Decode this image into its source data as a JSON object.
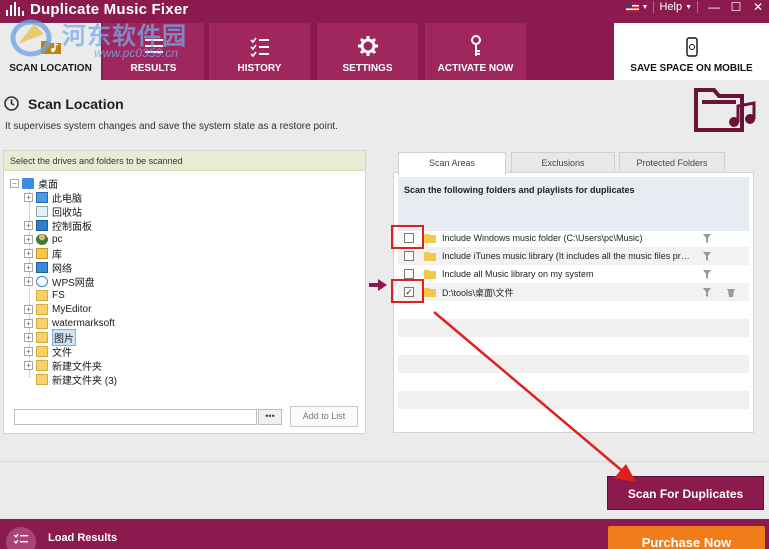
{
  "app": {
    "title": "Duplicate Music Fixer",
    "watermark_cn": "河东软件园",
    "watermark_url": "www.pc0359.cn",
    "help_label": "Help",
    "window_controls": [
      "—",
      "☐",
      "✕"
    ]
  },
  "tabs": [
    {
      "label": "SCAN LOCATION",
      "icon": "folder-music-icon",
      "active": true
    },
    {
      "label": "RESULTS",
      "icon": "list-icon",
      "active": false
    },
    {
      "label": "HISTORY",
      "icon": "checklist-icon",
      "active": false
    },
    {
      "label": "SETTINGS",
      "icon": "gear-icon",
      "active": false
    },
    {
      "label": "ACTIVATE NOW",
      "icon": "key-icon",
      "active": false
    }
  ],
  "mobile_tab": {
    "label": "SAVE SPACE ON MOBILE",
    "icon": "mobile-icon"
  },
  "page": {
    "title": "Scan Location",
    "subtitle": "It supervises system changes and save the system state as a restore point."
  },
  "left_panel": {
    "header": "Select the drives and folders to be scanned",
    "tree": [
      {
        "label": "桌面",
        "expander": "−",
        "icon": "desktop"
      },
      {
        "label": "此电脑",
        "expander": "+",
        "icon": "computer"
      },
      {
        "label": "回收站",
        "expander": "",
        "icon": "recycle"
      },
      {
        "label": "控制面板",
        "expander": "+",
        "icon": "control"
      },
      {
        "label": "pc",
        "expander": "+",
        "icon": "user"
      },
      {
        "label": "库",
        "expander": "+",
        "icon": "library"
      },
      {
        "label": "网络",
        "expander": "+",
        "icon": "network"
      },
      {
        "label": "WPS网盘",
        "expander": "+",
        "icon": "cloud"
      },
      {
        "label": "FS",
        "expander": "",
        "icon": "folder"
      },
      {
        "label": "MyEditor",
        "expander": "+",
        "icon": "folder"
      },
      {
        "label": "watermarksoft",
        "expander": "+",
        "icon": "folder"
      },
      {
        "label": "图片",
        "expander": "+",
        "icon": "folder",
        "selected": true
      },
      {
        "label": "文件",
        "expander": "+",
        "icon": "folder"
      },
      {
        "label": "新建文件夹",
        "expander": "+",
        "icon": "folder"
      },
      {
        "label": "新建文件夹 (3)",
        "expander": "",
        "icon": "folder"
      }
    ],
    "path_value": "",
    "browse_label": "•••",
    "add_button": "Add to List"
  },
  "right_panel": {
    "tabs": [
      "Scan Areas",
      "Exclusions",
      "Protected Folders"
    ],
    "active_tab": 0,
    "heading": "Scan the following folders and playlists for duplicates",
    "rows": [
      {
        "text": "Include Windows music folder (C:\\Users\\pc\\Music)",
        "checked": false
      },
      {
        "text": "Include iTunes music library (It includes all the music files present in iTunes)",
        "checked": false
      },
      {
        "text": "Include all Music library on my system",
        "checked": false
      },
      {
        "text": "D:\\tools\\桌面\\文件",
        "checked": true
      }
    ]
  },
  "actions": {
    "scan_button": "Scan For Duplicates"
  },
  "footer": {
    "load_label": "Load Results",
    "purchase_label": "Purchase Now"
  },
  "colors": {
    "brand": "#8b1a4e",
    "tab": "#a0275e",
    "accent": "#f07d1a",
    "annotation": "#e02020"
  }
}
